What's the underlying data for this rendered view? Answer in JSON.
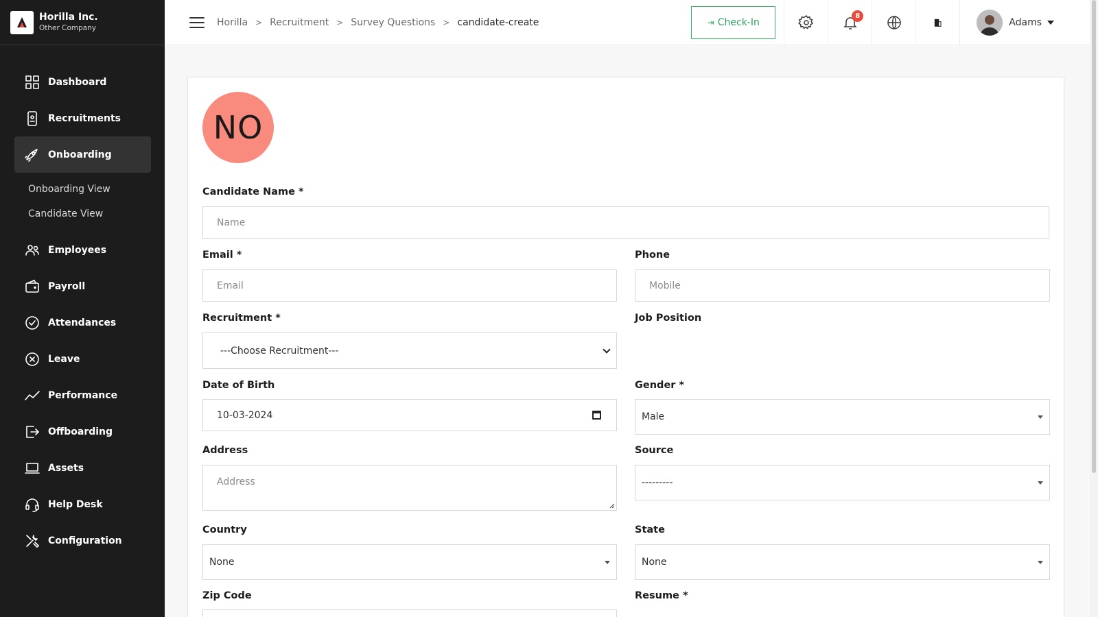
{
  "brand": {
    "name": "Horilla Inc.",
    "sub": "Other Company"
  },
  "sidebar": {
    "items": [
      {
        "label": "Dashboard",
        "icon": "dashboard-icon"
      },
      {
        "label": "Recruitments",
        "icon": "recruitment-icon"
      },
      {
        "label": "Onboarding",
        "icon": "rocket-icon",
        "active": true
      },
      {
        "label": "Employees",
        "icon": "users-icon"
      },
      {
        "label": "Payroll",
        "icon": "wallet-icon"
      },
      {
        "label": "Attendances",
        "icon": "check-circle-icon"
      },
      {
        "label": "Leave",
        "icon": "x-circle-icon"
      },
      {
        "label": "Performance",
        "icon": "trend-icon"
      },
      {
        "label": "Offboarding",
        "icon": "exit-icon"
      },
      {
        "label": "Assets",
        "icon": "laptop-icon"
      },
      {
        "label": "Help Desk",
        "icon": "headset-icon"
      },
      {
        "label": "Configuration",
        "icon": "tools-icon"
      }
    ],
    "subitems": [
      "Onboarding View",
      "Candidate View"
    ]
  },
  "header": {
    "breadcrumb": [
      "Horilla",
      "Recruitment",
      "Survey Questions",
      "candidate-create"
    ],
    "checkin_label": "Check-In",
    "notification_count": "8",
    "user_name": "Adams"
  },
  "form": {
    "initials": "NO",
    "candidate_name": {
      "label": "Candidate Name *",
      "placeholder": "Name"
    },
    "email": {
      "label": "Email *",
      "placeholder": "Email"
    },
    "phone": {
      "label": "Phone",
      "placeholder": "Mobile"
    },
    "recruitment": {
      "label": "Recruitment *",
      "value": "---Choose Recruitment---"
    },
    "job_position": {
      "label": "Job Position"
    },
    "dob": {
      "label": "Date of Birth",
      "value": "10-03-2024"
    },
    "gender": {
      "label": "Gender *",
      "value": "Male"
    },
    "address": {
      "label": "Address",
      "placeholder": "Address"
    },
    "source": {
      "label": "Source",
      "value": "---------"
    },
    "country": {
      "label": "Country",
      "value": "None"
    },
    "state": {
      "label": "State",
      "value": "None"
    },
    "zip": {
      "label": "Zip Code"
    },
    "resume": {
      "label": "Resume *"
    }
  },
  "colors": {
    "accent_green": "#3bb36a",
    "initials_bg": "#f98a7e",
    "sidebar_bg": "#1c1c1c",
    "badge_red": "#e94a3d"
  }
}
